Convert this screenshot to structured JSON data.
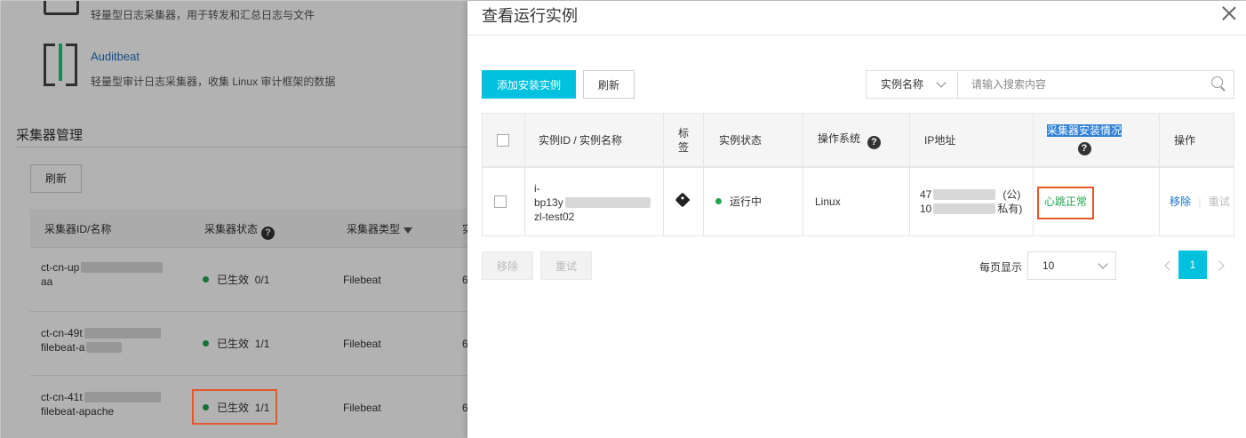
{
  "background": {
    "products": [
      {
        "name": "",
        "desc": "轻量型日志采集器，用于转发和汇总日志与文件"
      },
      {
        "name": "Auditbeat",
        "desc": "轻量型审计日志采集器，收集 Linux 审计框架的数据"
      }
    ],
    "section_title": "采集器管理",
    "refresh_label": "刷新",
    "columns": {
      "id_name": "采集器ID/名称",
      "status": "采集器状态",
      "type": "采集器类型",
      "extra": "实"
    },
    "rows": [
      {
        "line1": "ct-cn-up",
        "line2": "aa",
        "status": "已生效",
        "count": "0/1",
        "type": "Filebeat",
        "extra": "6"
      },
      {
        "line1": "ct-cn-49t",
        "line2": "filebeat-a",
        "status": "已生效",
        "count": "1/1",
        "type": "Filebeat",
        "extra": "6"
      },
      {
        "line1": "ct-cn-41t",
        "line2": "filebeat-apache",
        "status": "已生效",
        "count": "1/1",
        "type": "Filebeat",
        "extra": "6"
      }
    ]
  },
  "drawer": {
    "title": "查看运行实例",
    "add_button": "添加安装实例",
    "refresh_button": "刷新",
    "search": {
      "field": "实例名称",
      "placeholder": "请输入搜索内容"
    },
    "columns": {
      "id_name": "实例ID / 实例名称",
      "tag_1": "标",
      "tag_2": "签",
      "status": "实例状态",
      "os": "操作系统",
      "ip": "IP地址",
      "install": "采集器安装情况",
      "action": "操作"
    },
    "row": {
      "id_line1": "i-",
      "id_line2": "bp13y",
      "id_line3": "zl-test02",
      "status": "运行中",
      "os": "Linux",
      "ip_public_prefix": "47",
      "ip_public_suffix": "(公)",
      "ip_private_prefix": "10",
      "ip_private_suffix": "私有)",
      "install_status": "心跳正常",
      "action_remove": "移除",
      "action_retry": "重试"
    },
    "bulk": {
      "remove": "移除",
      "retry": "重试"
    },
    "pagination": {
      "per_page_label": "每页显示",
      "per_page_value": "10",
      "current_page": "1"
    },
    "colors": {
      "primary": "#00c1de",
      "success": "#1ea64a",
      "link": "#1a72c2",
      "highlight_border": "#e6572b"
    }
  }
}
